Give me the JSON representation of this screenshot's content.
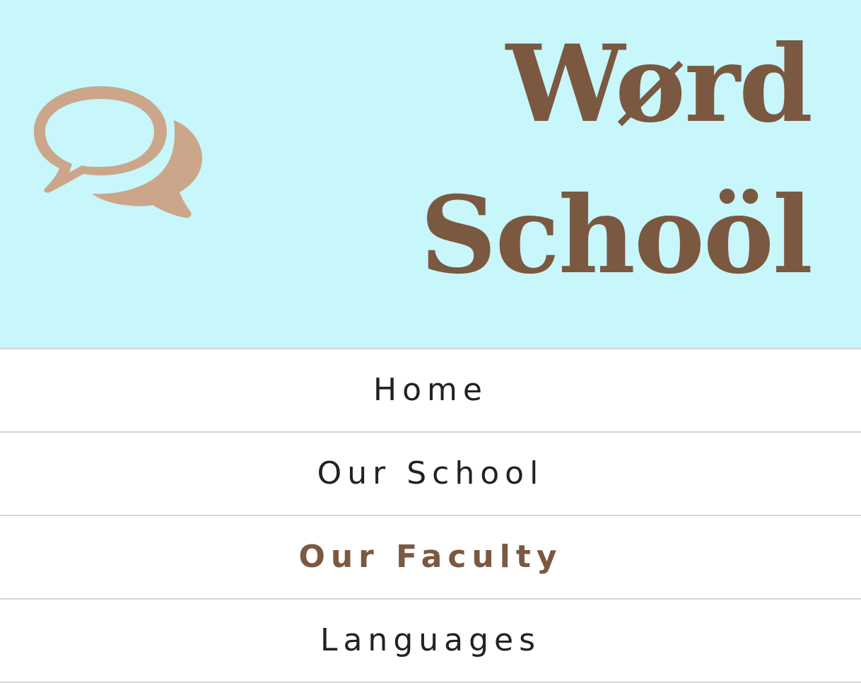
{
  "header": {
    "title_line1": "Wørd",
    "title_line2": "Schoöl",
    "logo_icon": "speech-bubbles-icon",
    "background_color": "#c7f6fb",
    "title_color": "#7b5840",
    "logo_color": "#cba68a"
  },
  "nav": {
    "items": [
      {
        "label": "Home",
        "active": false
      },
      {
        "label": "Our School",
        "active": false
      },
      {
        "label": "Our Faculty",
        "active": true
      },
      {
        "label": "Languages",
        "active": false
      }
    ],
    "active_color": "#7b5840"
  }
}
